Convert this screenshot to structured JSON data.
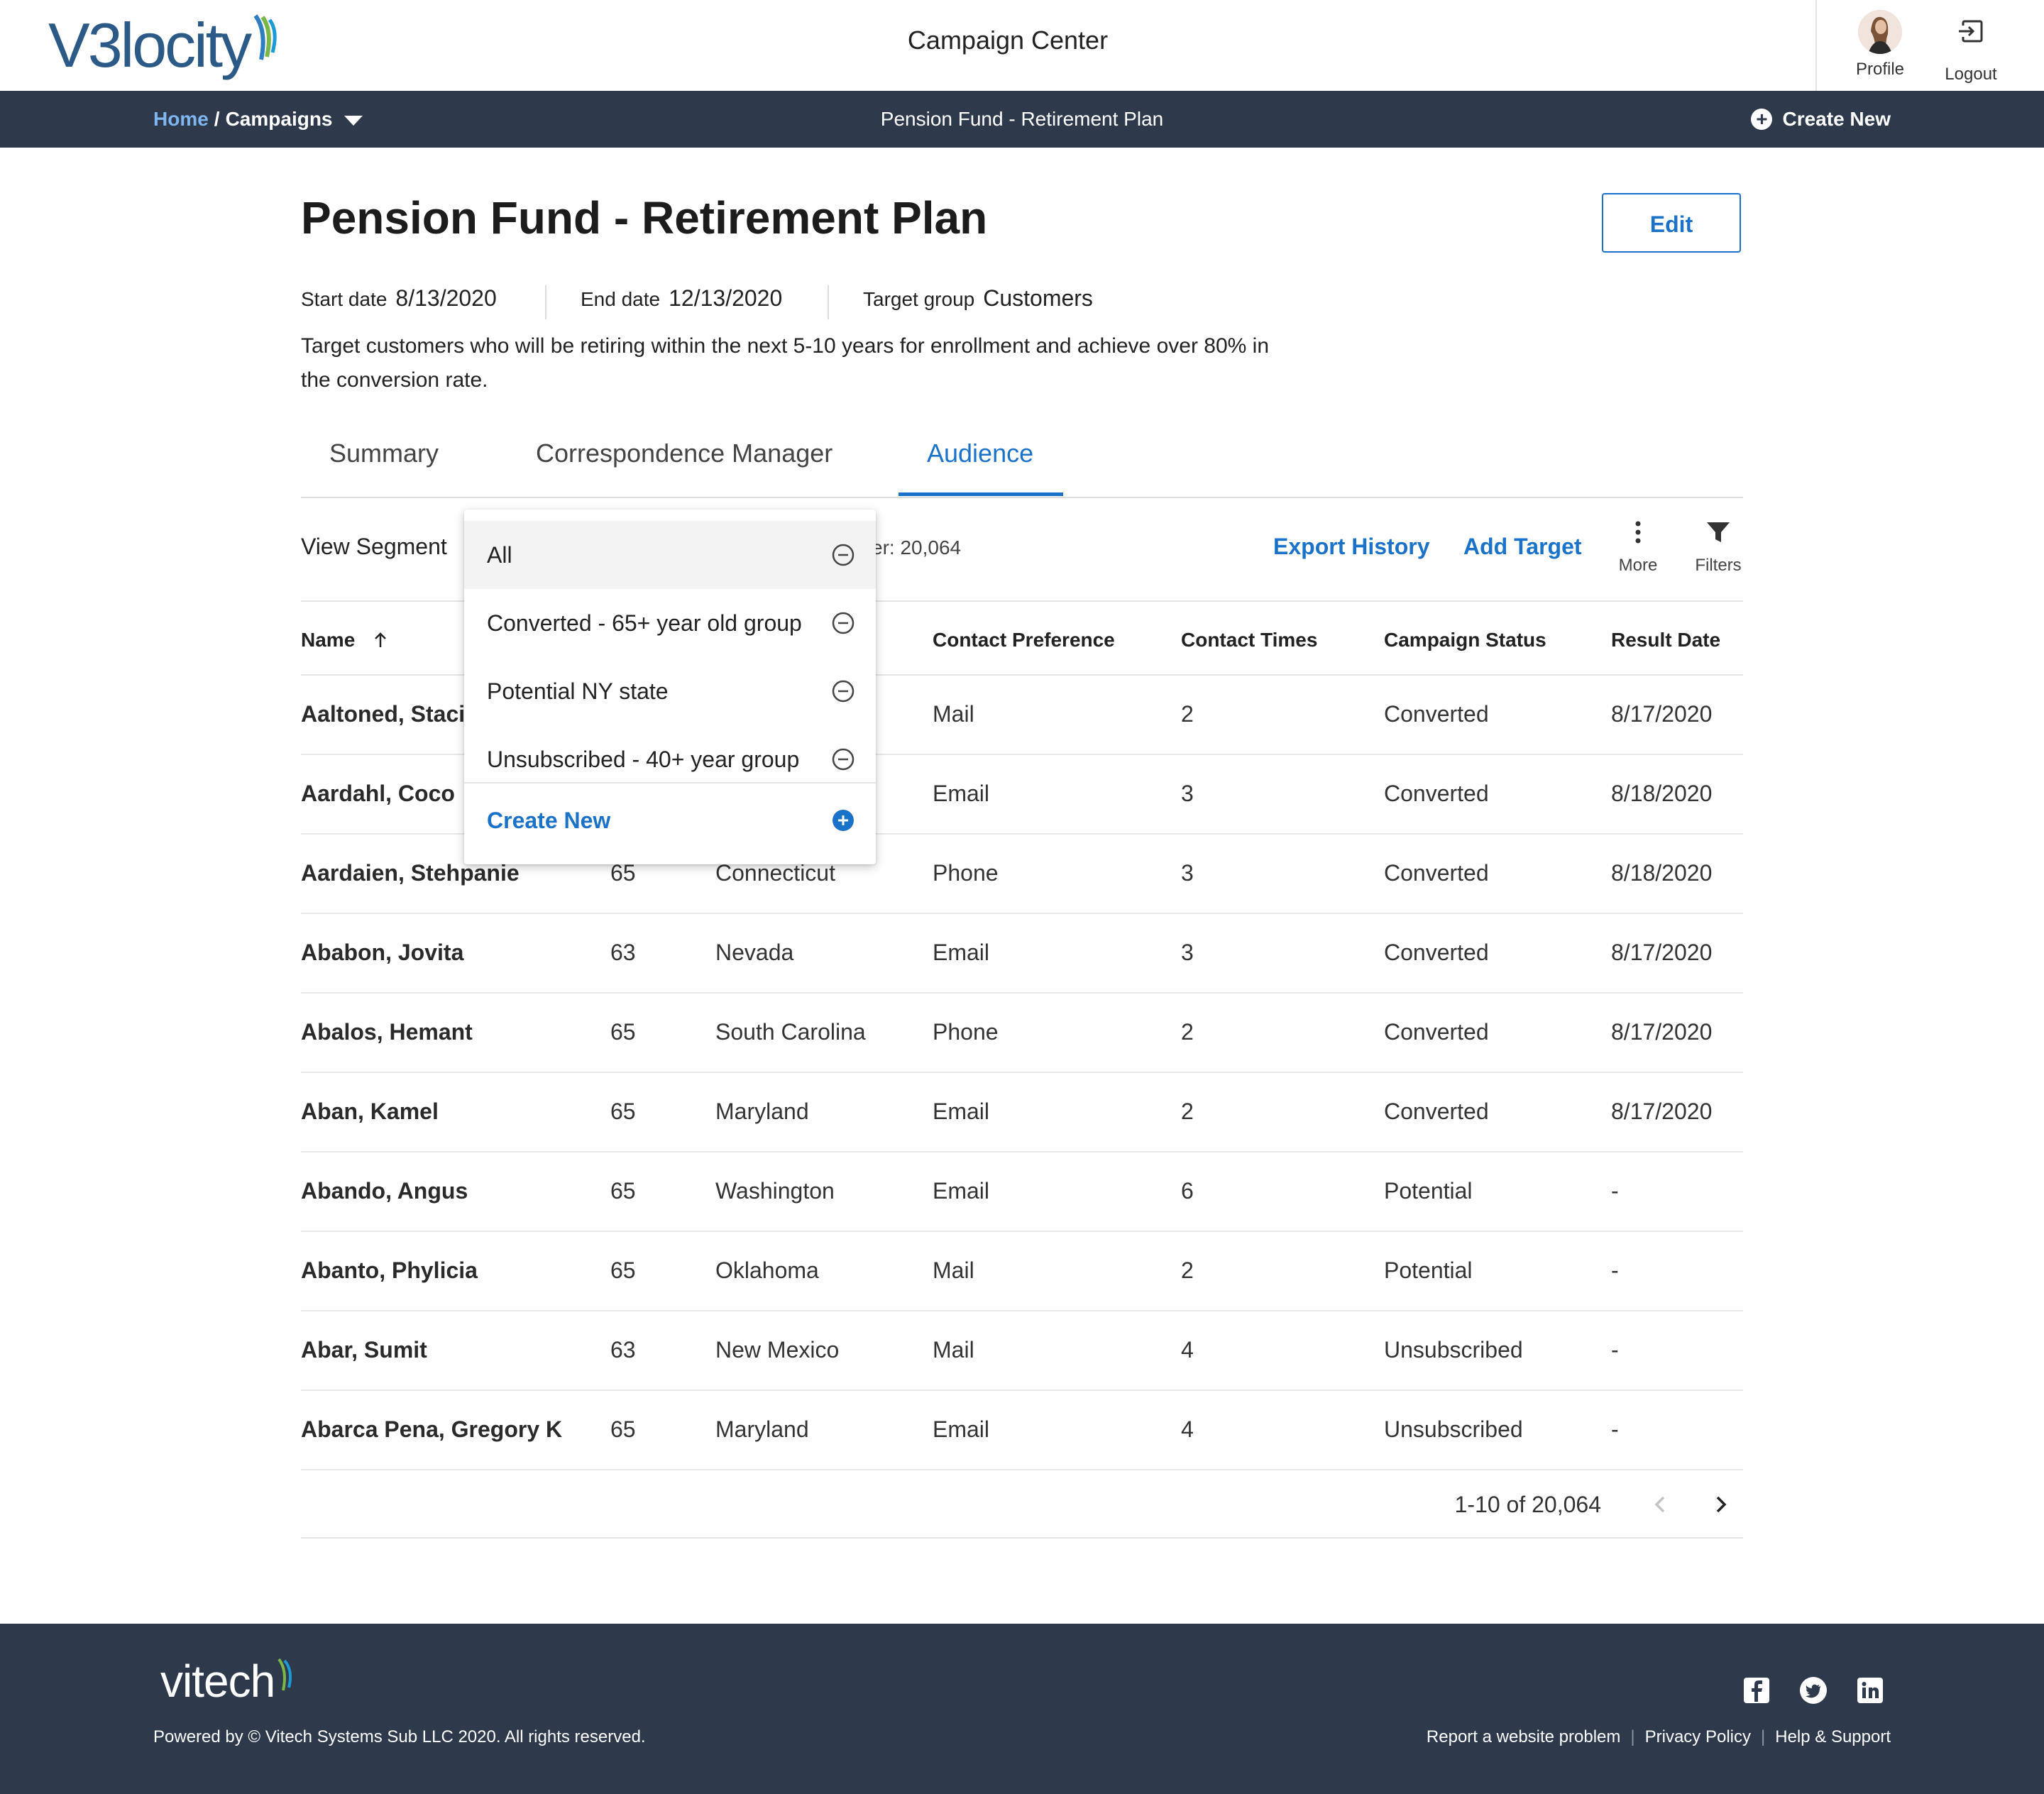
{
  "header": {
    "logo": "V3locity",
    "app_title": "Campaign Center",
    "profile_label": "Profile",
    "logout_label": "Logout"
  },
  "nav": {
    "home": "Home",
    "separator": "/",
    "campaigns": "Campaigns",
    "center_title": "Pension Fund - Retirement Plan",
    "create_new": "Create New"
  },
  "campaign": {
    "title": "Pension Fund - Retirement Plan",
    "edit_label": "Edit",
    "start_label": "Start date",
    "start_value": "8/13/2020",
    "end_label": "End date",
    "end_value": "12/13/2020",
    "target_label": "Target group",
    "target_value": "Customers",
    "description": "Target customers who will be retiring within the next 5-10 years for enrollment and achieve over 80% in the conversion rate."
  },
  "tabs": [
    {
      "label": "Summary",
      "active": false
    },
    {
      "label": "Correspondence Manager",
      "active": false
    },
    {
      "label": "Audience",
      "active": true
    }
  ],
  "toolbar": {
    "view_segment_label": "View Segment",
    "total_text": "er: 20,064",
    "export_history": "Export History",
    "add_target": "Add Target",
    "more_label": "More",
    "filters_label": "Filters"
  },
  "table": {
    "columns": [
      "Name",
      "",
      "",
      "Contact Preference",
      "Contact Times",
      "Campaign Status",
      "Result Date"
    ],
    "rows": [
      [
        "Aaltoned, Stacia",
        "",
        "",
        "Mail",
        "2",
        "Converted",
        "8/17/2020"
      ],
      [
        "Aardahl, Coco",
        "",
        "",
        "Email",
        "3",
        "Converted",
        "8/18/2020"
      ],
      [
        "Aardaien, Stehpanie",
        "65",
        "Connecticut",
        "Phone",
        "3",
        "Converted",
        "8/18/2020"
      ],
      [
        "Ababon, Jovita",
        "63",
        "Nevada",
        "Email",
        "3",
        "Converted",
        "8/17/2020"
      ],
      [
        "Abalos, Hemant",
        "65",
        "South Carolina",
        "Phone",
        "2",
        "Converted",
        "8/17/2020"
      ],
      [
        "Aban, Kamel",
        "65",
        "Maryland",
        "Email",
        "2",
        "Converted",
        "8/17/2020"
      ],
      [
        "Abando, Angus",
        "65",
        "Washington",
        "Email",
        "6",
        "Potential",
        "-"
      ],
      [
        "Abanto, Phylicia",
        "65",
        "Oklahoma",
        "Mail",
        "2",
        "Potential",
        "-"
      ],
      [
        "Abar, Sumit",
        "63",
        "New Mexico",
        "Mail",
        "4",
        "Unsubscribed",
        "-"
      ],
      [
        "Abarca Pena, Gregory K",
        "65",
        "Maryland",
        "Email",
        "4",
        "Unsubscribed",
        "-"
      ]
    ]
  },
  "pagination": {
    "range_text": "1-10 of 20,064"
  },
  "segment_dropdown": {
    "items": [
      "All",
      "Converted - 65+ year old group",
      "Potential NY state",
      "Unsubscribed - 40+ year group"
    ],
    "create_new": "Create New"
  },
  "footer": {
    "logo": "vitech",
    "copyright": "Powered by © Vitech Systems Sub LLC 2020. All rights reserved.",
    "links": [
      "Report a website problem",
      "Privacy Policy",
      "Help & Support"
    ]
  },
  "colors": {
    "accent": "#1a73c8",
    "navbar": "#2e3a4c",
    "breadcrumb_link": "#7fb6f0"
  }
}
